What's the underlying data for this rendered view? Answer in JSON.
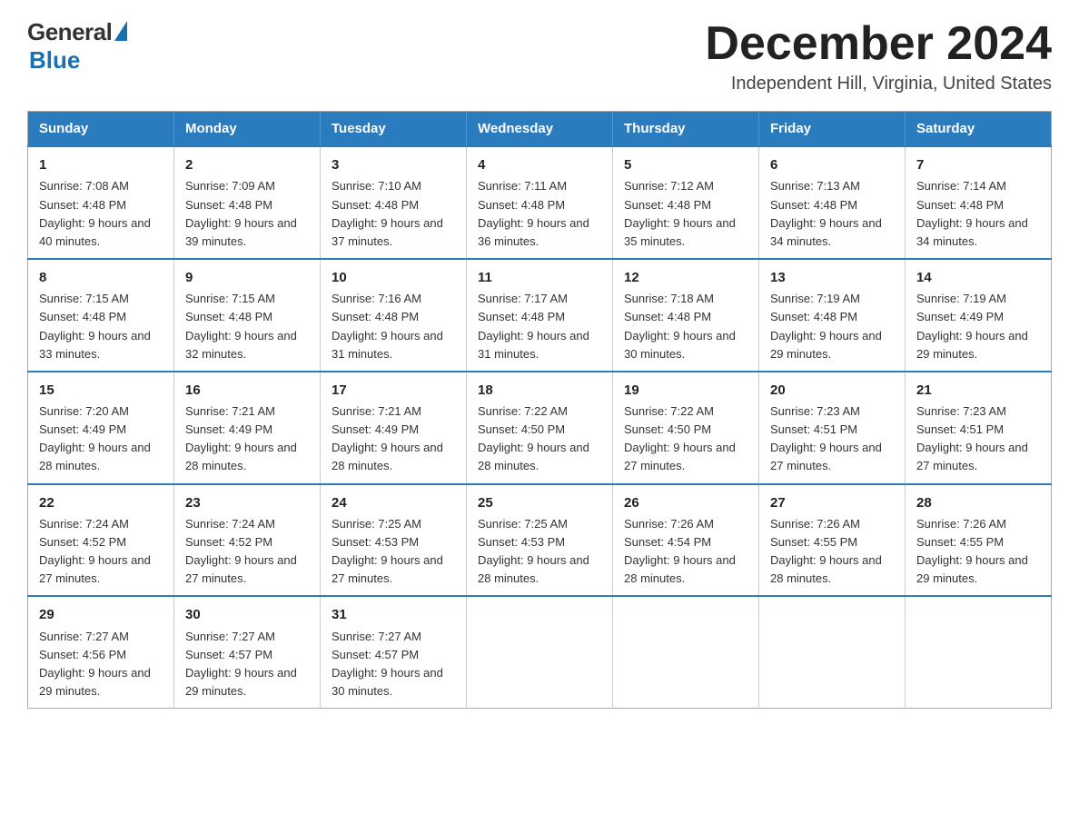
{
  "logo": {
    "general": "General",
    "blue": "Blue"
  },
  "title": "December 2024",
  "location": "Independent Hill, Virginia, United States",
  "days_of_week": [
    "Sunday",
    "Monday",
    "Tuesday",
    "Wednesday",
    "Thursday",
    "Friday",
    "Saturday"
  ],
  "weeks": [
    [
      {
        "day": "1",
        "sunrise": "7:08 AM",
        "sunset": "4:48 PM",
        "daylight": "9 hours and 40 minutes."
      },
      {
        "day": "2",
        "sunrise": "7:09 AM",
        "sunset": "4:48 PM",
        "daylight": "9 hours and 39 minutes."
      },
      {
        "day": "3",
        "sunrise": "7:10 AM",
        "sunset": "4:48 PM",
        "daylight": "9 hours and 37 minutes."
      },
      {
        "day": "4",
        "sunrise": "7:11 AM",
        "sunset": "4:48 PM",
        "daylight": "9 hours and 36 minutes."
      },
      {
        "day": "5",
        "sunrise": "7:12 AM",
        "sunset": "4:48 PM",
        "daylight": "9 hours and 35 minutes."
      },
      {
        "day": "6",
        "sunrise": "7:13 AM",
        "sunset": "4:48 PM",
        "daylight": "9 hours and 34 minutes."
      },
      {
        "day": "7",
        "sunrise": "7:14 AM",
        "sunset": "4:48 PM",
        "daylight": "9 hours and 34 minutes."
      }
    ],
    [
      {
        "day": "8",
        "sunrise": "7:15 AM",
        "sunset": "4:48 PM",
        "daylight": "9 hours and 33 minutes."
      },
      {
        "day": "9",
        "sunrise": "7:15 AM",
        "sunset": "4:48 PM",
        "daylight": "9 hours and 32 minutes."
      },
      {
        "day": "10",
        "sunrise": "7:16 AM",
        "sunset": "4:48 PM",
        "daylight": "9 hours and 31 minutes."
      },
      {
        "day": "11",
        "sunrise": "7:17 AM",
        "sunset": "4:48 PM",
        "daylight": "9 hours and 31 minutes."
      },
      {
        "day": "12",
        "sunrise": "7:18 AM",
        "sunset": "4:48 PM",
        "daylight": "9 hours and 30 minutes."
      },
      {
        "day": "13",
        "sunrise": "7:19 AM",
        "sunset": "4:48 PM",
        "daylight": "9 hours and 29 minutes."
      },
      {
        "day": "14",
        "sunrise": "7:19 AM",
        "sunset": "4:49 PM",
        "daylight": "9 hours and 29 minutes."
      }
    ],
    [
      {
        "day": "15",
        "sunrise": "7:20 AM",
        "sunset": "4:49 PM",
        "daylight": "9 hours and 28 minutes."
      },
      {
        "day": "16",
        "sunrise": "7:21 AM",
        "sunset": "4:49 PM",
        "daylight": "9 hours and 28 minutes."
      },
      {
        "day": "17",
        "sunrise": "7:21 AM",
        "sunset": "4:49 PM",
        "daylight": "9 hours and 28 minutes."
      },
      {
        "day": "18",
        "sunrise": "7:22 AM",
        "sunset": "4:50 PM",
        "daylight": "9 hours and 28 minutes."
      },
      {
        "day": "19",
        "sunrise": "7:22 AM",
        "sunset": "4:50 PM",
        "daylight": "9 hours and 27 minutes."
      },
      {
        "day": "20",
        "sunrise": "7:23 AM",
        "sunset": "4:51 PM",
        "daylight": "9 hours and 27 minutes."
      },
      {
        "day": "21",
        "sunrise": "7:23 AM",
        "sunset": "4:51 PM",
        "daylight": "9 hours and 27 minutes."
      }
    ],
    [
      {
        "day": "22",
        "sunrise": "7:24 AM",
        "sunset": "4:52 PM",
        "daylight": "9 hours and 27 minutes."
      },
      {
        "day": "23",
        "sunrise": "7:24 AM",
        "sunset": "4:52 PM",
        "daylight": "9 hours and 27 minutes."
      },
      {
        "day": "24",
        "sunrise": "7:25 AM",
        "sunset": "4:53 PM",
        "daylight": "9 hours and 27 minutes."
      },
      {
        "day": "25",
        "sunrise": "7:25 AM",
        "sunset": "4:53 PM",
        "daylight": "9 hours and 28 minutes."
      },
      {
        "day": "26",
        "sunrise": "7:26 AM",
        "sunset": "4:54 PM",
        "daylight": "9 hours and 28 minutes."
      },
      {
        "day": "27",
        "sunrise": "7:26 AM",
        "sunset": "4:55 PM",
        "daylight": "9 hours and 28 minutes."
      },
      {
        "day": "28",
        "sunrise": "7:26 AM",
        "sunset": "4:55 PM",
        "daylight": "9 hours and 29 minutes."
      }
    ],
    [
      {
        "day": "29",
        "sunrise": "7:27 AM",
        "sunset": "4:56 PM",
        "daylight": "9 hours and 29 minutes."
      },
      {
        "day": "30",
        "sunrise": "7:27 AM",
        "sunset": "4:57 PM",
        "daylight": "9 hours and 29 minutes."
      },
      {
        "day": "31",
        "sunrise": "7:27 AM",
        "sunset": "4:57 PM",
        "daylight": "9 hours and 30 minutes."
      },
      null,
      null,
      null,
      null
    ]
  ],
  "labels": {
    "sunrise": "Sunrise:",
    "sunset": "Sunset:",
    "daylight": "Daylight:"
  }
}
